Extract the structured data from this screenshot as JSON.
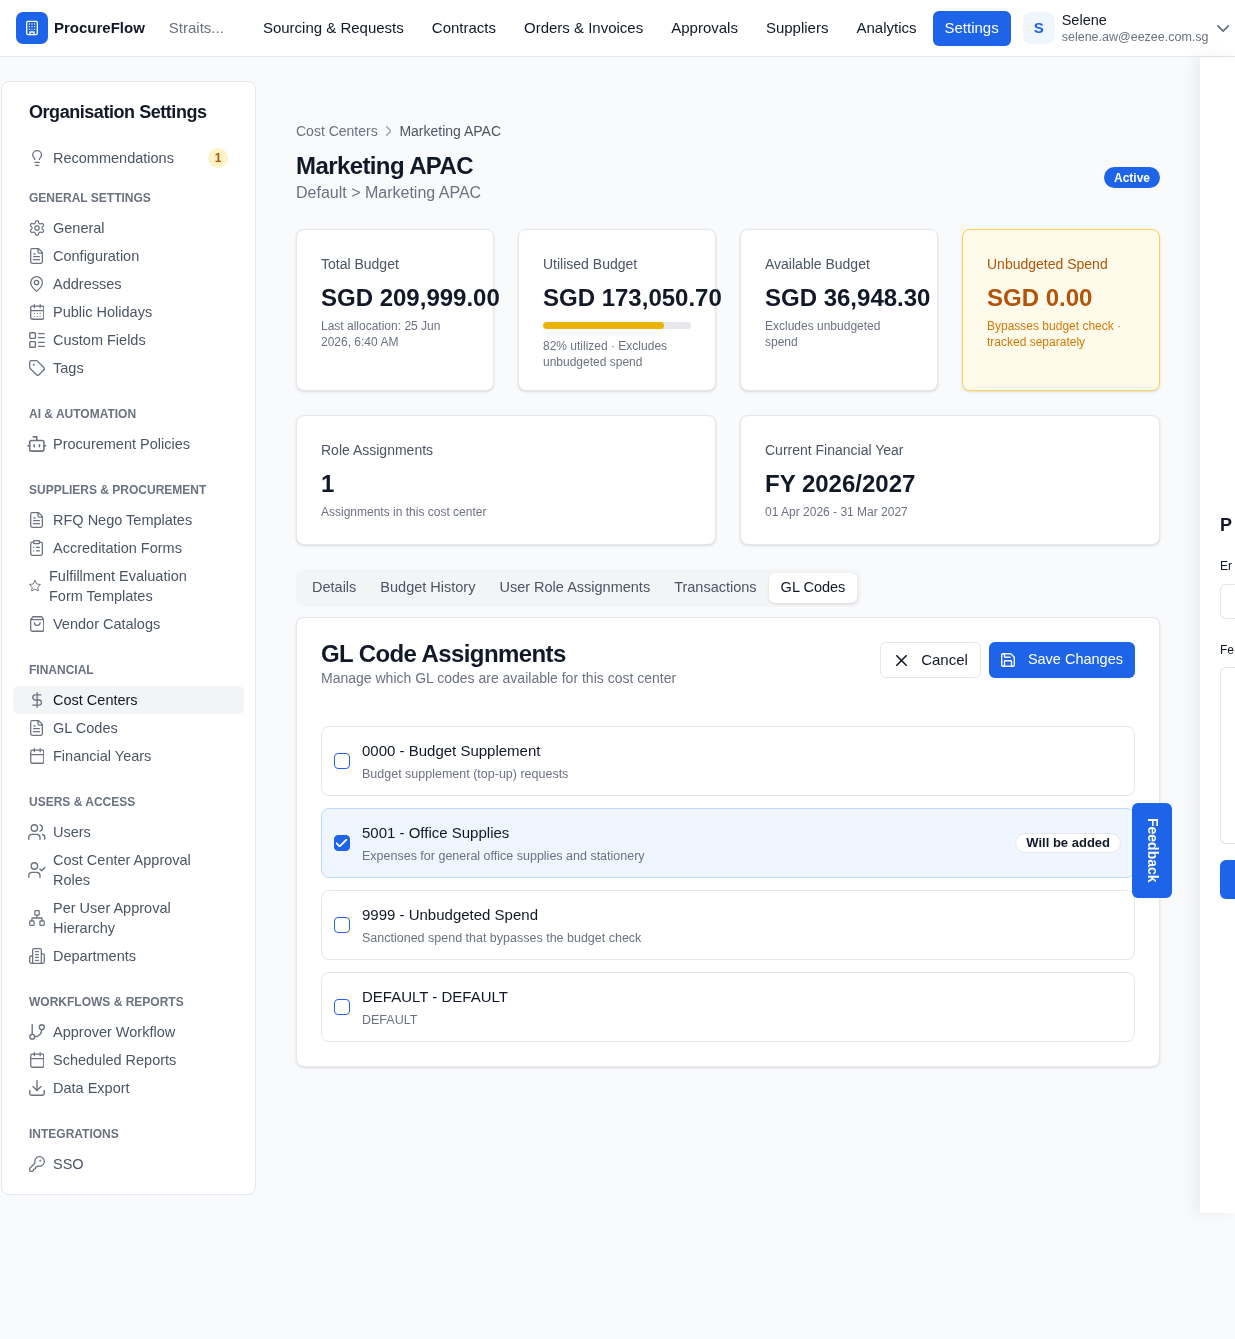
{
  "nav": {
    "brand": "ProcureFlow",
    "organization": "Straits...",
    "links": [
      {
        "label": "Sourcing & Requests",
        "selected": false
      },
      {
        "label": "Contracts",
        "selected": false
      },
      {
        "label": "Orders & Invoices",
        "selected": false
      },
      {
        "label": "Approvals",
        "selected": false
      },
      {
        "label": "Suppliers",
        "selected": false
      },
      {
        "label": "Analytics",
        "selected": false
      },
      {
        "label": "Settings",
        "selected": true
      }
    ],
    "user": {
      "initial": "S",
      "name": "Selene",
      "email": "selene.aw@eezee.com.sg"
    }
  },
  "sidebar": {
    "title": "Organisation Settings",
    "top_item": {
      "label": "Recommendations",
      "badge": "1",
      "selected": false
    },
    "sections": [
      {
        "heading": "GENERAL SETTINGS",
        "items": [
          {
            "label": "General",
            "selected": false
          },
          {
            "label": "Configuration",
            "selected": false
          },
          {
            "label": "Addresses",
            "selected": false
          },
          {
            "label": "Public Holidays",
            "selected": false
          },
          {
            "label": "Custom Fields",
            "selected": false
          },
          {
            "label": "Tags",
            "selected": false
          }
        ]
      },
      {
        "heading": "AI & AUTOMATION",
        "items": [
          {
            "label": "Procurement Policies",
            "selected": false
          }
        ]
      },
      {
        "heading": "SUPPLIERS & PROCUREMENT",
        "items": [
          {
            "label": "RFQ Nego Templates",
            "selected": false
          },
          {
            "label": "Accreditation Forms",
            "selected": false
          },
          {
            "label": "Fulfillment Evaluation Form Templates",
            "selected": false
          },
          {
            "label": "Vendor Catalogs",
            "selected": false
          }
        ]
      },
      {
        "heading": "FINANCIAL",
        "items": [
          {
            "label": "Cost Centers",
            "selected": true
          },
          {
            "label": "GL Codes",
            "selected": false
          },
          {
            "label": "Financial Years",
            "selected": false
          }
        ]
      },
      {
        "heading": "USERS & ACCESS",
        "items": [
          {
            "label": "Users",
            "selected": false
          },
          {
            "label": "Cost Center Approval Roles",
            "selected": false
          },
          {
            "label": "Per User Approval Hierarchy",
            "selected": false
          },
          {
            "label": "Departments",
            "selected": false
          }
        ]
      },
      {
        "heading": "WORKFLOWS & REPORTS",
        "items": [
          {
            "label": "Approver Workflow",
            "selected": false
          },
          {
            "label": "Scheduled Reports",
            "selected": false
          },
          {
            "label": "Data Export",
            "selected": false
          }
        ]
      },
      {
        "heading": "INTEGRATIONS",
        "items": [
          {
            "label": "SSO",
            "selected": false
          }
        ]
      }
    ]
  },
  "page": {
    "breadcrumb": [
      {
        "label": "Cost Centers"
      },
      {
        "label": "Marketing APAC"
      }
    ],
    "title": "Marketing APAC",
    "path": "Default > Marketing APAC",
    "status": "Active"
  },
  "stats": [
    {
      "kind": "plain",
      "label": "Total Budget",
      "value": "SGD 209,999.00",
      "note": "Last allocation: 25 Jun 2026, 6:40 AM"
    },
    {
      "kind": "progress",
      "label": "Utilised Budget",
      "value": "SGD 173,050.70",
      "level": 0.82,
      "note": "82% utilized · Excludes unbudgeted spend"
    },
    {
      "kind": "plain",
      "label": "Available Budget",
      "value": "SGD 36,948.30",
      "note": "Excludes unbudgeted spend"
    },
    {
      "kind": "warning",
      "label": "Unbudgeted Spend",
      "value": "SGD 0.00",
      "note": "Bypasses budget check · tracked separately"
    }
  ],
  "summary": [
    {
      "label": "Role Assignments",
      "value": "1",
      "note": "Assignments in this cost center"
    },
    {
      "label": "Current Financial Year",
      "value": "FY 2026/2027",
      "note": "01 Apr 2026 - 31 Mar 2027"
    }
  ],
  "tabs": [
    {
      "label": "Details",
      "selected": false
    },
    {
      "label": "Budget History",
      "selected": false
    },
    {
      "label": "User Role Assignments",
      "selected": false
    },
    {
      "label": "Transactions",
      "selected": false
    },
    {
      "label": "GL Codes",
      "selected": true
    }
  ],
  "gl_panel": {
    "title": "GL Code Assignments",
    "subtitle": "Manage which GL codes are available for this cost center",
    "buttons": [
      {
        "kind": "cancel",
        "label": "Cancel"
      },
      {
        "kind": "save",
        "label": "Save Changes"
      }
    ],
    "codes": [
      {
        "name": "0000 - Budget Supplement",
        "description": "Budget supplement (top-up) requests",
        "checked": false
      },
      {
        "name": "5001 - Office Supplies",
        "description": "Expenses for general office supplies and stationery",
        "checked": true,
        "badge": "Will be added"
      },
      {
        "name": "9999 - Unbudgeted Spend",
        "description": "Sanctioned spend that bypasses the budget check",
        "checked": false
      },
      {
        "name": "DEFAULT - DEFAULT",
        "description": "DEFAULT",
        "checked": false
      }
    ]
  },
  "feedback_tab": {
    "label": "Feedback"
  },
  "side_panel": {
    "heading": "P",
    "fields": [
      {
        "kind": "input",
        "label": "Er"
      },
      {
        "kind": "textarea",
        "label": "Fe"
      }
    ]
  }
}
